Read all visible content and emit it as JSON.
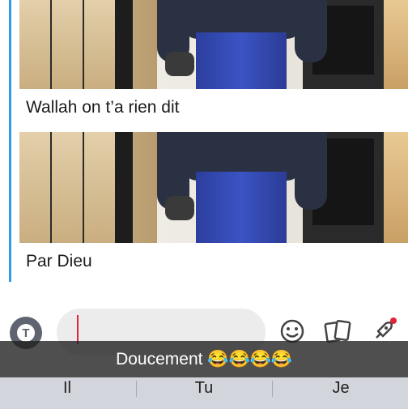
{
  "messages": [
    {
      "caption": "Wallah on t’a rien dit"
    },
    {
      "caption": "Par Dieu"
    }
  ],
  "composer": {
    "t_button_label": "T",
    "emoji_icon": "smiley-face-icon",
    "cards_icon": "cards-icon",
    "rocket_icon": "rocket-icon"
  },
  "overlay_caption": "Doucement 😂😂😂😂",
  "keyboard": {
    "suggestions": [
      "Il",
      "Tu",
      "Je"
    ]
  },
  "colors": {
    "accent": "#2f9ee6",
    "cursor": "#e0243a"
  }
}
